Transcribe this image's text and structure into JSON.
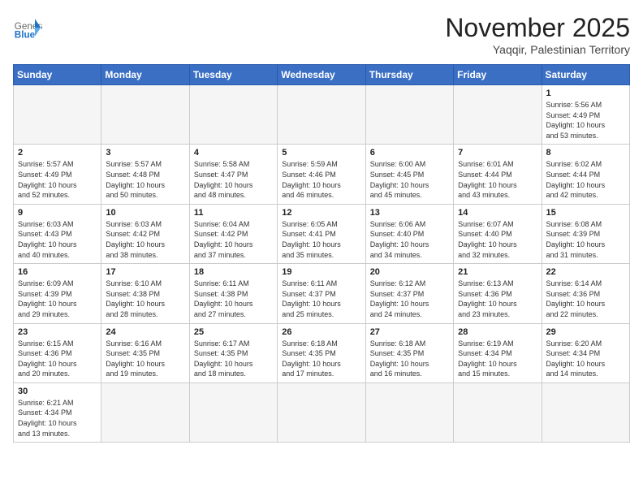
{
  "header": {
    "logo_general": "General",
    "logo_blue": "Blue",
    "month_title": "November 2025",
    "subtitle": "Yaqqir, Palestinian Territory"
  },
  "weekdays": [
    "Sunday",
    "Monday",
    "Tuesday",
    "Wednesday",
    "Thursday",
    "Friday",
    "Saturday"
  ],
  "days": [
    {
      "num": "",
      "info": ""
    },
    {
      "num": "",
      "info": ""
    },
    {
      "num": "",
      "info": ""
    },
    {
      "num": "",
      "info": ""
    },
    {
      "num": "",
      "info": ""
    },
    {
      "num": "",
      "info": ""
    },
    {
      "num": "1",
      "info": "Sunrise: 5:56 AM\nSunset: 4:49 PM\nDaylight: 10 hours\nand 53 minutes."
    },
    {
      "num": "2",
      "info": "Sunrise: 5:57 AM\nSunset: 4:49 PM\nDaylight: 10 hours\nand 52 minutes."
    },
    {
      "num": "3",
      "info": "Sunrise: 5:57 AM\nSunset: 4:48 PM\nDaylight: 10 hours\nand 50 minutes."
    },
    {
      "num": "4",
      "info": "Sunrise: 5:58 AM\nSunset: 4:47 PM\nDaylight: 10 hours\nand 48 minutes."
    },
    {
      "num": "5",
      "info": "Sunrise: 5:59 AM\nSunset: 4:46 PM\nDaylight: 10 hours\nand 46 minutes."
    },
    {
      "num": "6",
      "info": "Sunrise: 6:00 AM\nSunset: 4:45 PM\nDaylight: 10 hours\nand 45 minutes."
    },
    {
      "num": "7",
      "info": "Sunrise: 6:01 AM\nSunset: 4:44 PM\nDaylight: 10 hours\nand 43 minutes."
    },
    {
      "num": "8",
      "info": "Sunrise: 6:02 AM\nSunset: 4:44 PM\nDaylight: 10 hours\nand 42 minutes."
    },
    {
      "num": "9",
      "info": "Sunrise: 6:03 AM\nSunset: 4:43 PM\nDaylight: 10 hours\nand 40 minutes."
    },
    {
      "num": "10",
      "info": "Sunrise: 6:03 AM\nSunset: 4:42 PM\nDaylight: 10 hours\nand 38 minutes."
    },
    {
      "num": "11",
      "info": "Sunrise: 6:04 AM\nSunset: 4:42 PM\nDaylight: 10 hours\nand 37 minutes."
    },
    {
      "num": "12",
      "info": "Sunrise: 6:05 AM\nSunset: 4:41 PM\nDaylight: 10 hours\nand 35 minutes."
    },
    {
      "num": "13",
      "info": "Sunrise: 6:06 AM\nSunset: 4:40 PM\nDaylight: 10 hours\nand 34 minutes."
    },
    {
      "num": "14",
      "info": "Sunrise: 6:07 AM\nSunset: 4:40 PM\nDaylight: 10 hours\nand 32 minutes."
    },
    {
      "num": "15",
      "info": "Sunrise: 6:08 AM\nSunset: 4:39 PM\nDaylight: 10 hours\nand 31 minutes."
    },
    {
      "num": "16",
      "info": "Sunrise: 6:09 AM\nSunset: 4:39 PM\nDaylight: 10 hours\nand 29 minutes."
    },
    {
      "num": "17",
      "info": "Sunrise: 6:10 AM\nSunset: 4:38 PM\nDaylight: 10 hours\nand 28 minutes."
    },
    {
      "num": "18",
      "info": "Sunrise: 6:11 AM\nSunset: 4:38 PM\nDaylight: 10 hours\nand 27 minutes."
    },
    {
      "num": "19",
      "info": "Sunrise: 6:11 AM\nSunset: 4:37 PM\nDaylight: 10 hours\nand 25 minutes."
    },
    {
      "num": "20",
      "info": "Sunrise: 6:12 AM\nSunset: 4:37 PM\nDaylight: 10 hours\nand 24 minutes."
    },
    {
      "num": "21",
      "info": "Sunrise: 6:13 AM\nSunset: 4:36 PM\nDaylight: 10 hours\nand 23 minutes."
    },
    {
      "num": "22",
      "info": "Sunrise: 6:14 AM\nSunset: 4:36 PM\nDaylight: 10 hours\nand 22 minutes."
    },
    {
      "num": "23",
      "info": "Sunrise: 6:15 AM\nSunset: 4:36 PM\nDaylight: 10 hours\nand 20 minutes."
    },
    {
      "num": "24",
      "info": "Sunrise: 6:16 AM\nSunset: 4:35 PM\nDaylight: 10 hours\nand 19 minutes."
    },
    {
      "num": "25",
      "info": "Sunrise: 6:17 AM\nSunset: 4:35 PM\nDaylight: 10 hours\nand 18 minutes."
    },
    {
      "num": "26",
      "info": "Sunrise: 6:18 AM\nSunset: 4:35 PM\nDaylight: 10 hours\nand 17 minutes."
    },
    {
      "num": "27",
      "info": "Sunrise: 6:18 AM\nSunset: 4:35 PM\nDaylight: 10 hours\nand 16 minutes."
    },
    {
      "num": "28",
      "info": "Sunrise: 6:19 AM\nSunset: 4:34 PM\nDaylight: 10 hours\nand 15 minutes."
    },
    {
      "num": "29",
      "info": "Sunrise: 6:20 AM\nSunset: 4:34 PM\nDaylight: 10 hours\nand 14 minutes."
    },
    {
      "num": "30",
      "info": "Sunrise: 6:21 AM\nSunset: 4:34 PM\nDaylight: 10 hours\nand 13 minutes."
    },
    {
      "num": "",
      "info": ""
    },
    {
      "num": "",
      "info": ""
    },
    {
      "num": "",
      "info": ""
    },
    {
      "num": "",
      "info": ""
    },
    {
      "num": "",
      "info": ""
    },
    {
      "num": "",
      "info": ""
    }
  ]
}
